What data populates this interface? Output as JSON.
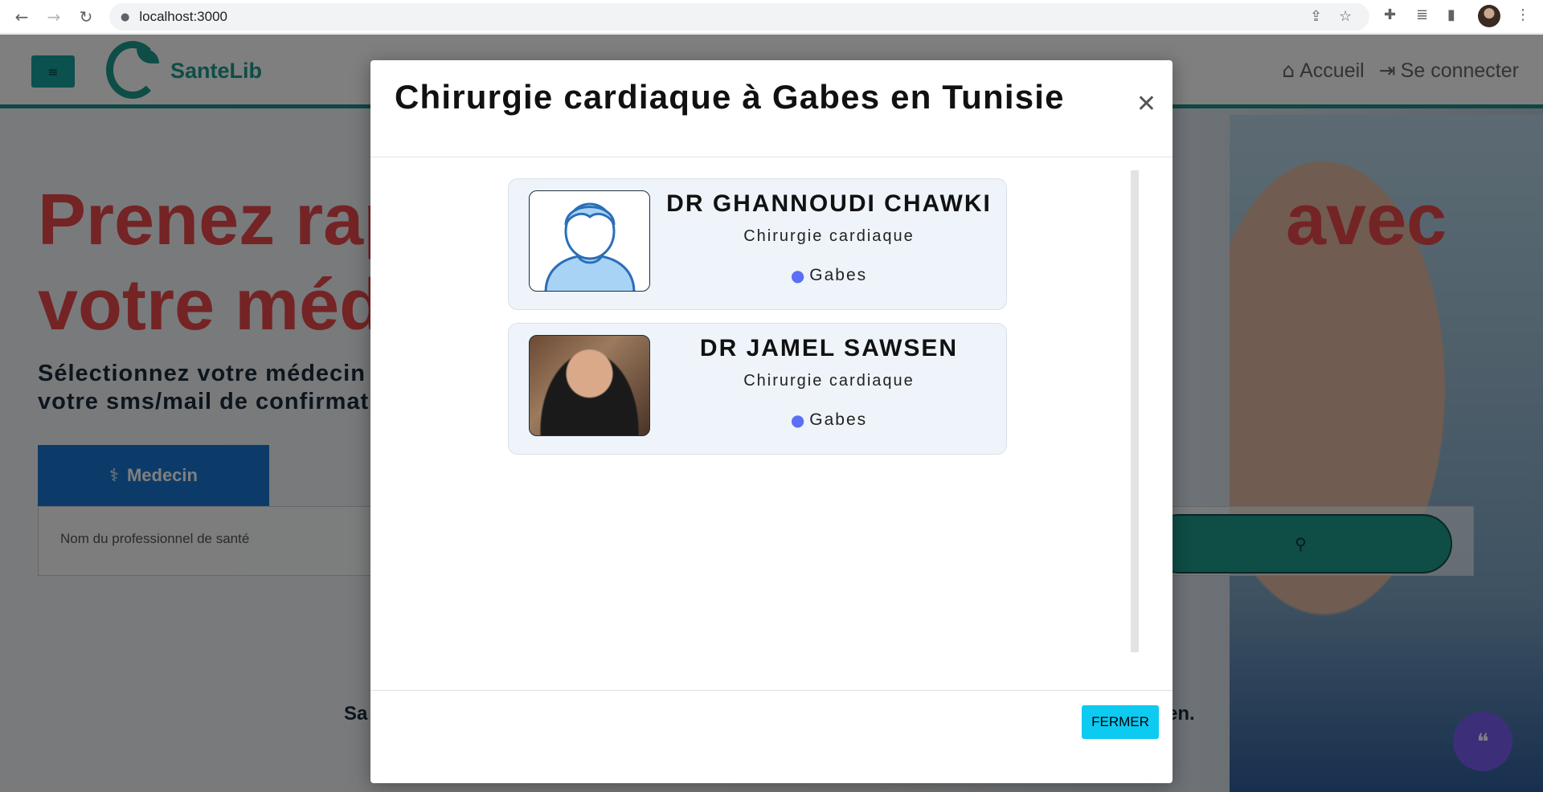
{
  "browser": {
    "url": "localhost:3000",
    "back_icon": "←",
    "forward_icon": "→",
    "reload_icon": "↻",
    "lock_icon": "🔒"
  },
  "header": {
    "menu_icon": "≡",
    "logo_text": "SanteLib",
    "links": [
      {
        "icon": "⌂",
        "label": "Accueil"
      },
      {
        "icon": "⇥",
        "label": "Se connecter"
      }
    ]
  },
  "hero": {
    "title_left": "Prenez rap\nvotre méde",
    "title_right": "avec",
    "subtitle": "Sélectionnez votre médecin\nvotre sms/mail de confirmat",
    "tab_label": "Medecin",
    "tab_icon": "⚕",
    "search_placeholder": "Nom du professionnel de santé",
    "search_icon": "🔍",
    "bottom_left": "Sa",
    "bottom_right": "en."
  },
  "modal": {
    "title": "Chirurgie cardiaque à Gabes en Tunisie",
    "close_icon": "✕",
    "doctors": [
      {
        "name": "DR GHANNOUDI CHAWKI",
        "specialty": "Chirurgie cardiaque",
        "city": "Gabes",
        "avatar": "default-avatar"
      },
      {
        "name": "DR JAMEL SAWSEN",
        "specialty": "Chirurgie cardiaque",
        "city": "Gabes",
        "avatar": "photo"
      }
    ],
    "close_button": "FERMER"
  },
  "chat_icon": "💬"
}
